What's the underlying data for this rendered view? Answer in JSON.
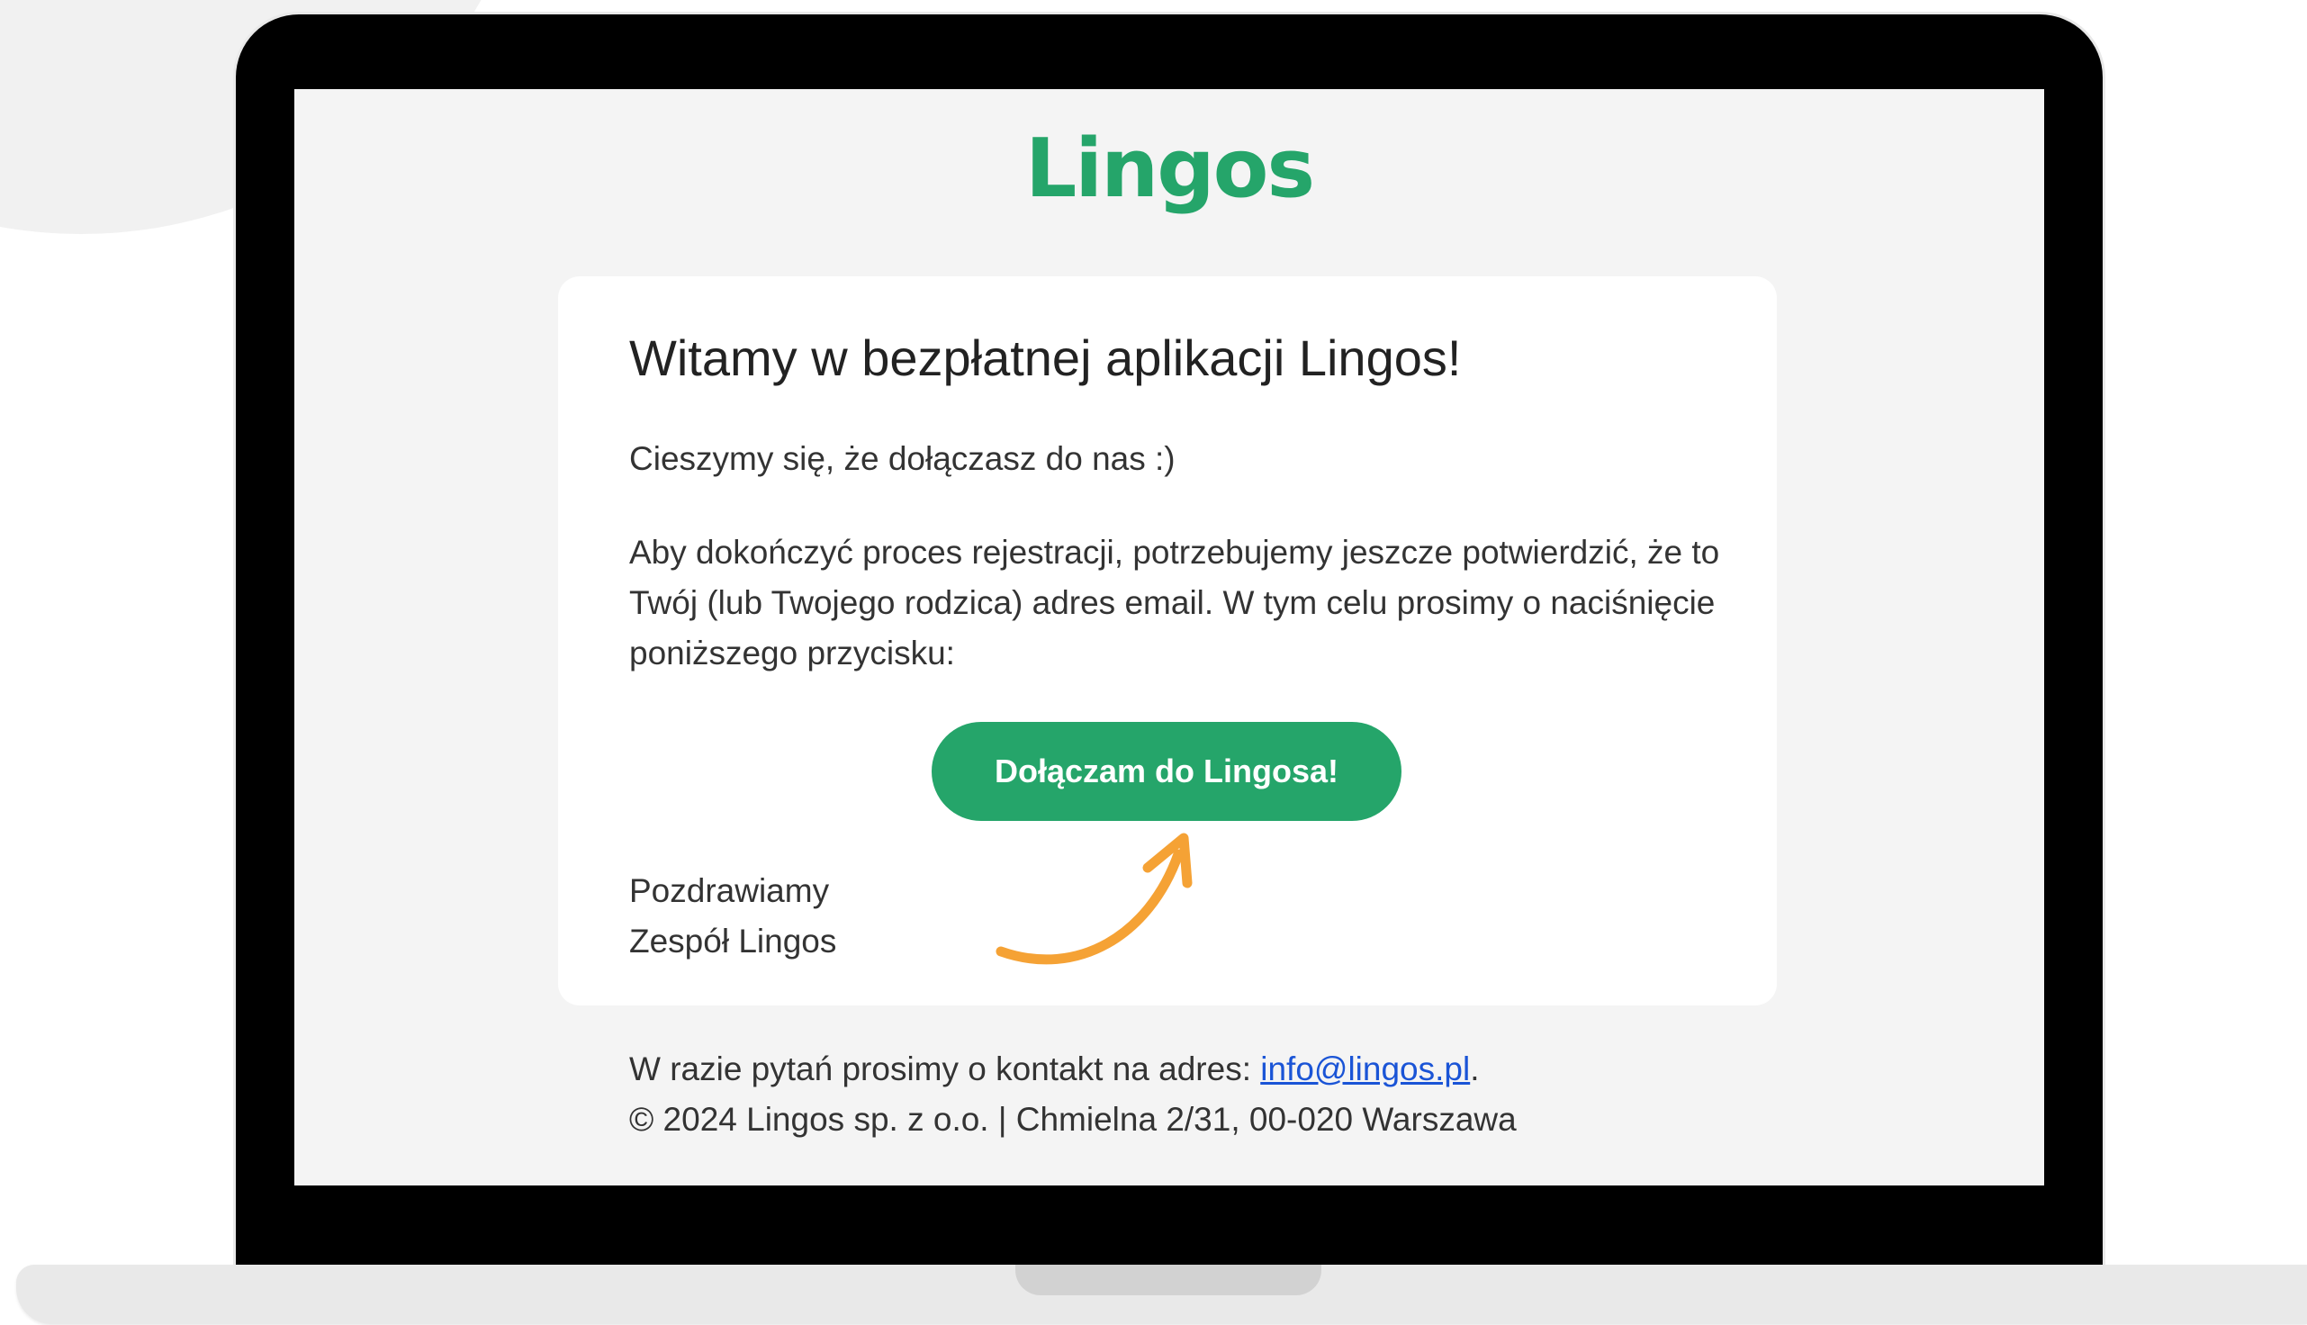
{
  "brand": {
    "logo_text": "Lingos",
    "accent_color": "#25a56a",
    "arrow_color": "#f5a235"
  },
  "email": {
    "heading": "Witamy w bezpłatnej aplikacji Lingos!",
    "greeting_line": "Cieszymy się, że dołączasz do nas :)",
    "body_text": "Aby dokończyć proces rejestracji, potrzebujemy jeszcze potwierdzić, że to Twój (lub Twojego rodzica) adres email. W tym celu prosimy o naciśnięcie poniższego przycisku:",
    "cta_label": "Dołączam do Lingosa!",
    "sign_off": "Pozdrawiamy",
    "signature": "Zespół Lingos"
  },
  "footer": {
    "contact_prefix": "W razie pytań prosimy o kontakt na adres: ",
    "contact_email": "info@lingos.pl",
    "contact_suffix": ".",
    "copyright": "© 2024 Lingos sp. z o.o. | Chmielna 2/31, 00-020 Warszawa"
  },
  "decor": {
    "arrow_icon": "curved-arrow-icon"
  }
}
